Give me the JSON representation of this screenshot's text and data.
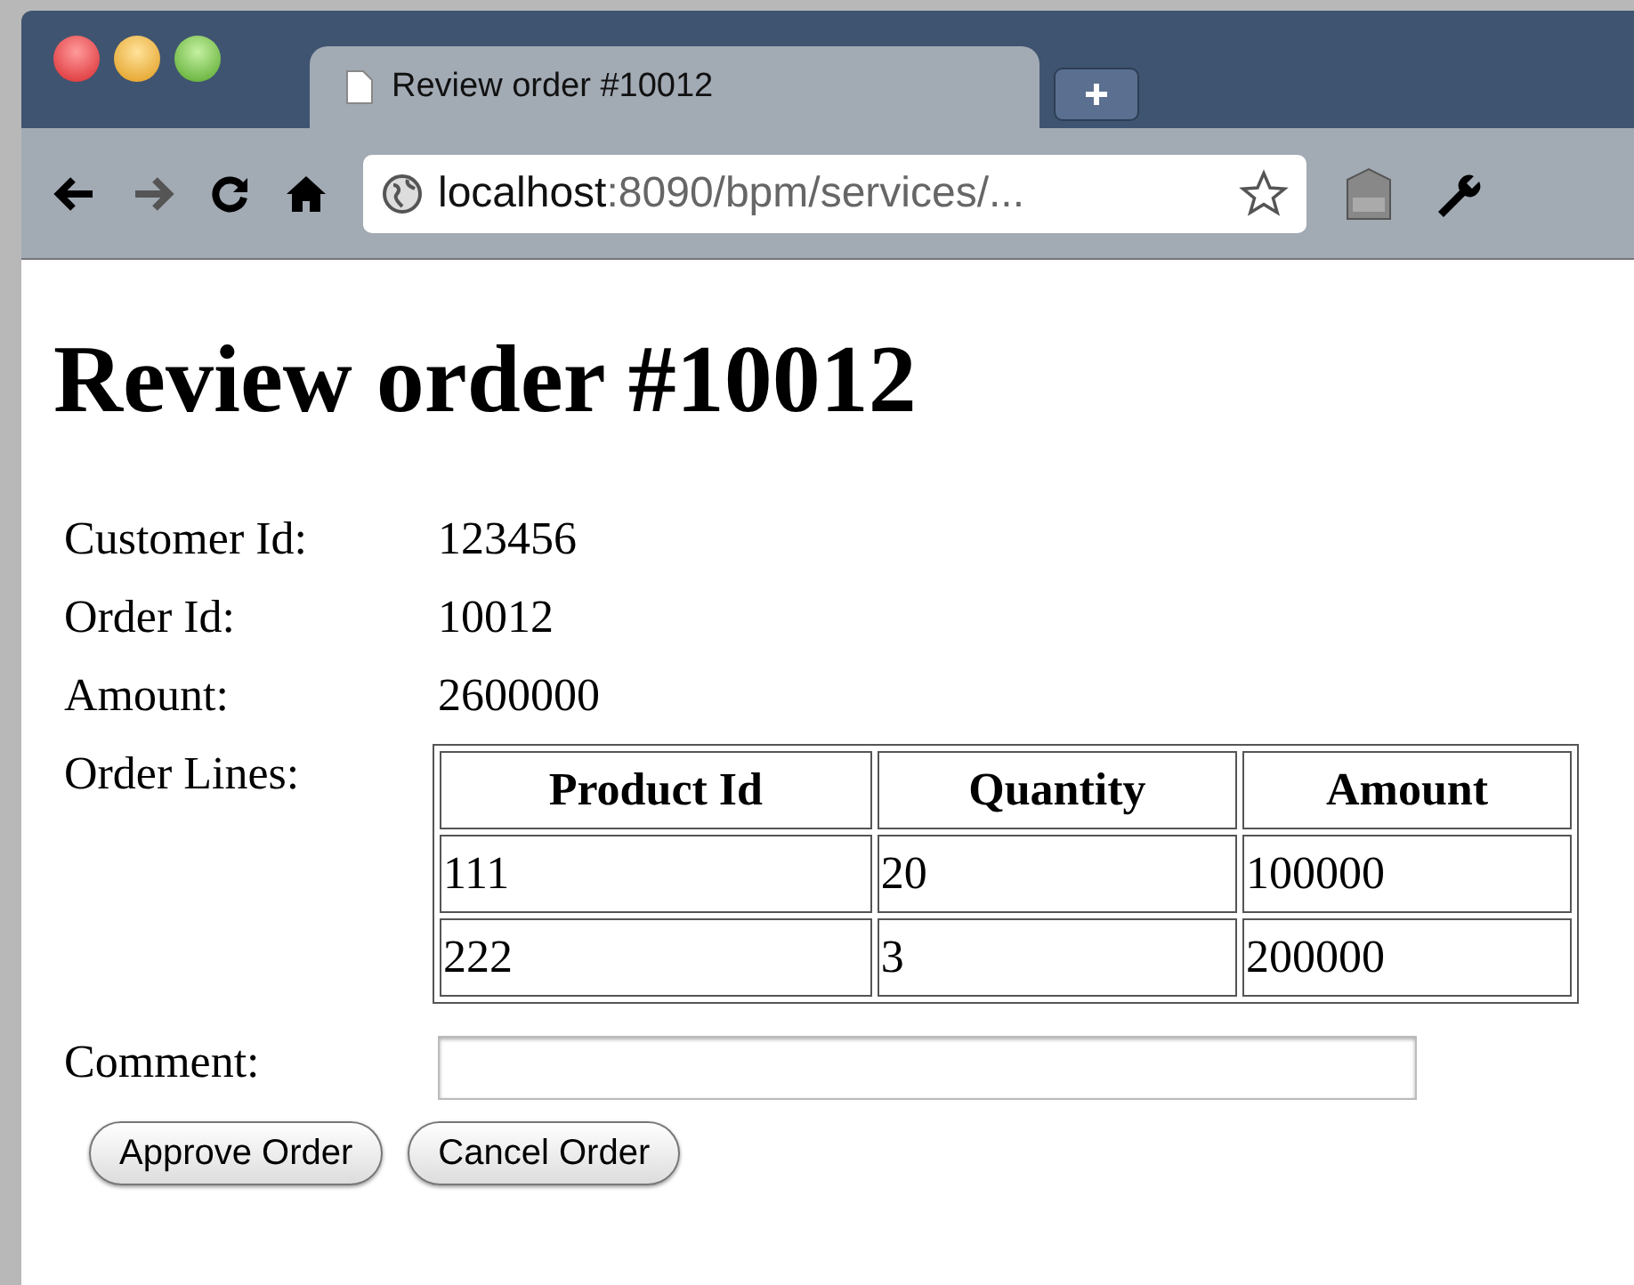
{
  "tab": {
    "title": "Review order #10012",
    "selected": true
  },
  "address_bar": {
    "host": "localhost",
    "path": ":8090/bpm/services/..."
  },
  "heading": "Review order #10012",
  "fields": [
    {
      "label": "Customer Id:",
      "value": "123456"
    },
    {
      "label": "Order Id:",
      "value": "10012"
    },
    {
      "label": "Amount:",
      "value": "2600000"
    }
  ],
  "order_lines": {
    "label": "Order Lines:",
    "columns": [
      "Product Id",
      "Quantity",
      "Amount"
    ],
    "rows": [
      [
        "111",
        "20",
        "100000"
      ],
      [
        "222",
        "3",
        "200000"
      ]
    ]
  },
  "comment": {
    "label": "Comment:"
  },
  "buttons": [
    "Approve Order",
    "Cancel Order"
  ]
}
